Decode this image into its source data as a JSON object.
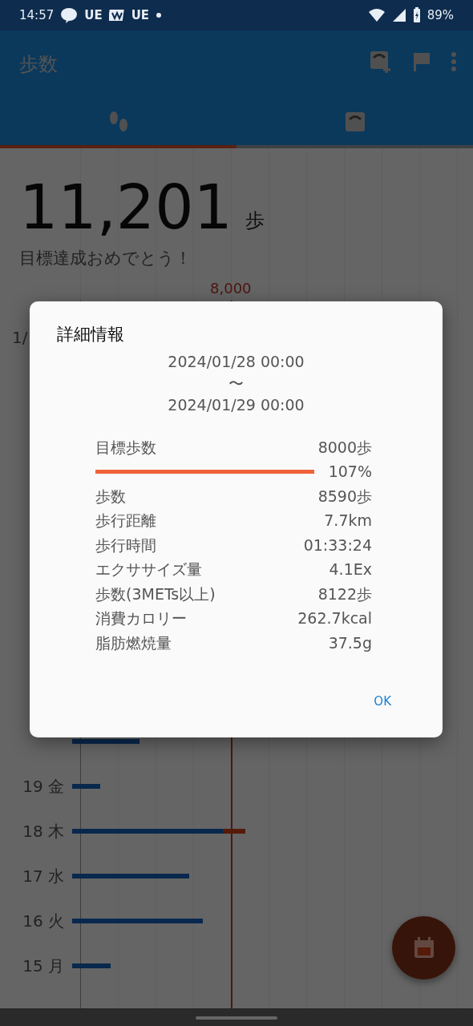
{
  "status_bar": {
    "time": "14:57",
    "notifications": [
      "UE",
      "UE"
    ],
    "battery": "89%"
  },
  "app_bar": {
    "title": "歩数"
  },
  "tabs": [
    {
      "selected": true
    },
    {
      "selected": false
    }
  ],
  "summary": {
    "steps": "11,201",
    "unit": "歩",
    "message": "目標達成おめでとう！"
  },
  "chart": {
    "goal_label": "8,000",
    "rows": [
      {
        "label": "1/"
      },
      {},
      {
        "label": "19 金"
      },
      {
        "label": "18 木"
      },
      {
        "label": "17 水"
      },
      {
        "label": "16 火"
      },
      {
        "label": "15 月"
      }
    ]
  },
  "dialog": {
    "title": "詳細情報",
    "date_from": "2024/01/28 00:00",
    "separator": "〜",
    "date_to": "2024/01/29 00:00",
    "goal": {
      "label": "目標歩数",
      "value": "8000歩",
      "level": 1,
      "percent": "107%"
    },
    "rows": [
      {
        "label": "歩数",
        "value": "8590歩"
      },
      {
        "label": "歩行距離",
        "value": "7.7km"
      },
      {
        "label": "歩行時間",
        "value": "01:33:24"
      },
      {
        "label": "エクササイズ量",
        "value": "4.1Ex"
      },
      {
        "label": "歩数(3METs以上)",
        "value": "8122歩"
      },
      {
        "label": "消費カロリー",
        "value": "262.7kcal"
      },
      {
        "label": "脂肪燃焼量",
        "value": "37.5g"
      }
    ],
    "ok": "OK"
  }
}
